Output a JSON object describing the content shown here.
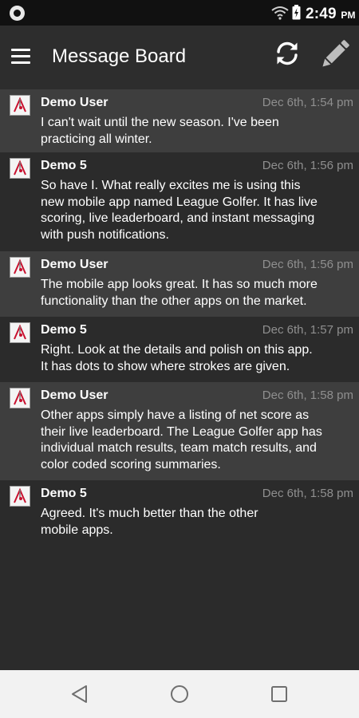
{
  "status_bar": {
    "time": "2:49",
    "ampm": "PM",
    "icons": [
      "notification-icon",
      "wifi-icon",
      "battery-charging-icon"
    ]
  },
  "app_bar": {
    "title": "Message Board",
    "icons": [
      "hamburger-menu-icon",
      "refresh-icon",
      "edit-pencil-icon"
    ]
  },
  "messages": [
    {
      "author": "Demo User",
      "time": "Dec 6th, 1:54 pm",
      "lines": [
        "I can't wait until the new season. I've been",
        "practicing all winter."
      ]
    },
    {
      "author": "Demo 5",
      "time": "Dec 6th, 1:56 pm",
      "lines": [
        "So have I. What really excites me is using this",
        "new mobile app named League Golfer. It has live",
        "scoring, live leaderboard, and instant messaging",
        "with push notifications."
      ]
    },
    {
      "author": "Demo User",
      "time": "Dec 6th, 1:56 pm",
      "lines": [
        "The mobile app looks great. It has so much more",
        "functionality than the other apps on the market."
      ]
    },
    {
      "author": "Demo 5",
      "time": "Dec 6th, 1:57 pm",
      "lines": [
        "Right. Look at the details and polish on this app.",
        "It has dots to show where strokes are given."
      ]
    },
    {
      "author": "Demo User",
      "time": "Dec 6th, 1:58 pm",
      "lines": [
        "Other apps simply have a listing of net score as",
        "their live leaderboard. The League Golfer app has",
        "individual match results, team match results, and",
        "color coded scoring summaries."
      ]
    },
    {
      "author": "Demo 5",
      "time": "Dec 6th, 1:58 pm",
      "lines": [
        "Agreed. It's much better than the other",
        "mobile apps."
      ]
    }
  ],
  "nav_bar": {
    "icons": [
      "back-icon",
      "home-icon",
      "recents-icon"
    ]
  },
  "colors": {
    "background": "#2b2b2b",
    "row_alt": "#3e3e3e",
    "timestamp": "#8f8f8f",
    "nav_bar": "#f2f2f2"
  }
}
